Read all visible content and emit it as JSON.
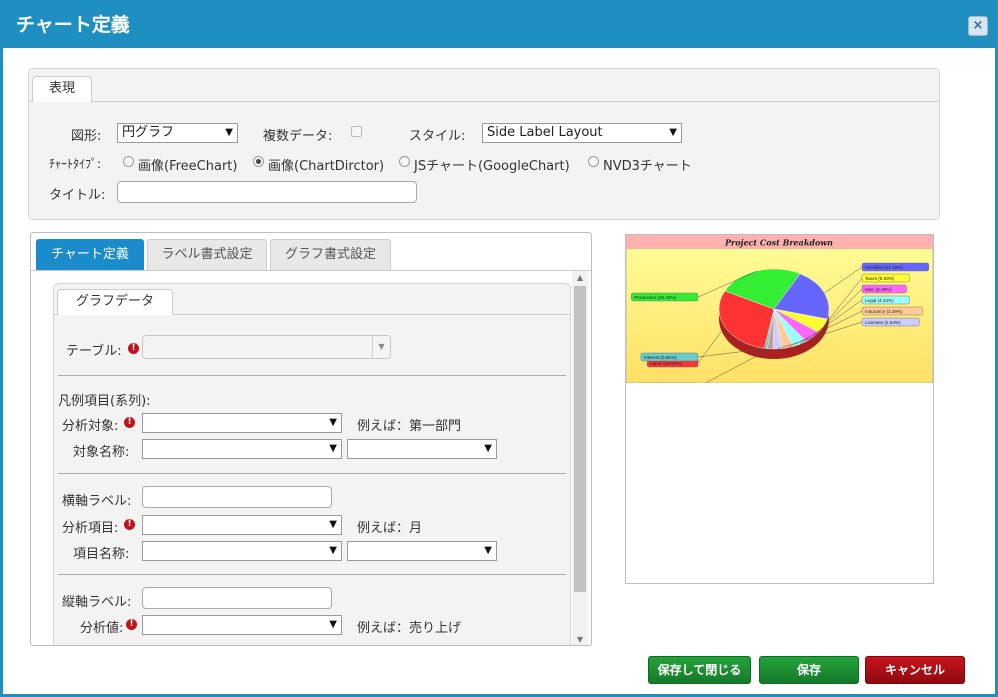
{
  "dialog": {
    "title": "チャート定義",
    "close_icon": "×"
  },
  "top_panel": {
    "tab_label": "表現",
    "shape_label": "図形:",
    "shape_value": "円グラフ",
    "multi_data_label": "複数データ:",
    "style_label": "スタイル:",
    "style_value": "Side Label Layout",
    "chart_type_label": "ﾁｬｰﾄﾀｲﾌﾟ:",
    "chart_type_options": [
      "画像(FreeChart)",
      "画像(ChartDirctor)",
      "JSチャート(GoogleChart)",
      "NVD3チャート"
    ],
    "title_label": "タイトル:",
    "title_value": ""
  },
  "left_panel": {
    "tabs": [
      "チャート定義",
      "ラベル書式設定",
      "グラフ書式設定"
    ],
    "inner_tab": "グラフデータ",
    "table_label": "テーブル:",
    "legend_section": "凡例項目(系列):",
    "analysis_target_label": "分析対象:",
    "analysis_target_hint": "例えば：第一部門",
    "target_name_label": "対象名称:",
    "x_axis_label": "横軸ラベル:",
    "analysis_item_label": "分析項目:",
    "analysis_item_hint": "例えば：月",
    "item_name_label": "項目名称:",
    "y_axis_label": "縦軸ラベル:",
    "analysis_value_label": "分析値:",
    "analysis_value_hint": "例えば：売り上げ"
  },
  "preview": {
    "chart_title": "Project Cost Breakdown",
    "labels": [
      "Facilities (21.19%)",
      "Taxes (5.93%)",
      "Misc (5.08%)",
      "Legal (4.24%)",
      "Insurance (3.39%)",
      "Licenses (2.54%)",
      "Transport (1.69%)",
      "Interest (0.85%)",
      "Production (25.42%)",
      "Labor (29.66%)"
    ]
  },
  "chart_data": {
    "type": "pie",
    "title": "Project Cost Breakdown",
    "categories": [
      "Labor",
      "Production",
      "Facilities",
      "Taxes",
      "Misc",
      "Legal",
      "Insurance",
      "Licenses",
      "Transport",
      "Interest"
    ],
    "values": [
      29.66,
      25.42,
      21.19,
      5.93,
      5.08,
      4.24,
      3.39,
      2.54,
      1.69,
      0.85
    ],
    "colors": [
      "#ff3333",
      "#33ee33",
      "#6666ff",
      "#ffff33",
      "#ff66ff",
      "#99ffff",
      "#ffcc99",
      "#ccccff",
      "#cc9999",
      "#66cccc"
    ]
  },
  "footer": {
    "save_close": "保存して閉じる",
    "save": "保存",
    "cancel": "キャンセル"
  }
}
